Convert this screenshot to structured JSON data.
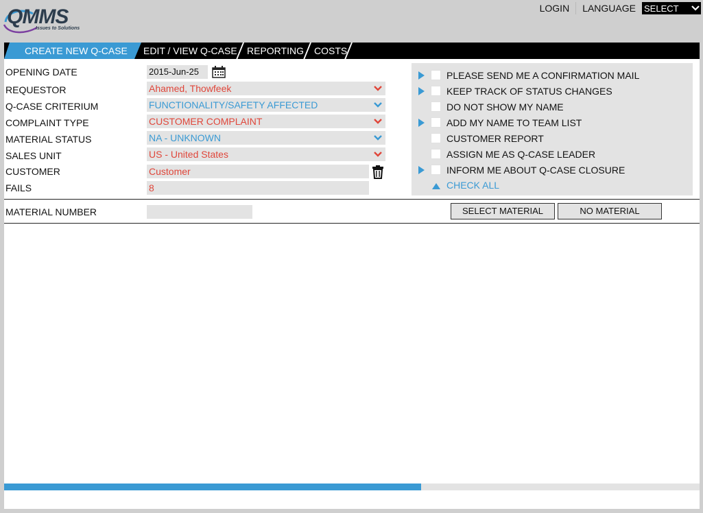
{
  "header": {
    "logo_text": "QMMS",
    "logo_tagline": "Issues to Solutions",
    "login_label": "LOGIN",
    "language_label": "LANGUAGE",
    "language_select_value": "SELECT"
  },
  "tabs": [
    {
      "label": "CREATE NEW Q-CASE",
      "active": true
    },
    {
      "label": "EDIT / VIEW Q-CASE",
      "active": false
    },
    {
      "label": "REPORTING",
      "active": false
    },
    {
      "label": "COSTS",
      "active": false
    }
  ],
  "form": {
    "opening_date": {
      "label": "OPENING DATE",
      "value": "2015-Jun-25"
    },
    "requestor": {
      "label": "REQUESTOR",
      "value": "Ahamed, Thowfeek"
    },
    "criterium": {
      "label": "Q-CASE CRITERIUM",
      "value": "FUNCTIONALITY/SAFETY AFFECTED"
    },
    "complaint_type": {
      "label": "COMPLAINT TYPE",
      "value": "CUSTOMER COMPLAINT"
    },
    "material_status": {
      "label": "MATERIAL STATUS",
      "value": "NA - UNKNOWN"
    },
    "sales_unit": {
      "label": "SALES UNIT",
      "value": "US - United States"
    },
    "customer": {
      "label": "CUSTOMER",
      "value": "Customer"
    },
    "fails": {
      "label": "FAILS",
      "value": "8"
    }
  },
  "options": {
    "items": [
      {
        "label": "PLEASE SEND ME A CONFIRMATION MAIL",
        "has_arrow": true
      },
      {
        "label": "KEEP TRACK OF STATUS CHANGES",
        "has_arrow": true
      },
      {
        "label": "DO NOT SHOW MY NAME",
        "has_arrow": false
      },
      {
        "label": "ADD MY NAME TO TEAM LIST",
        "has_arrow": true
      },
      {
        "label": "CUSTOMER REPORT",
        "has_arrow": false
      },
      {
        "label": "ASSIGN ME AS Q-CASE LEADER",
        "has_arrow": false
      },
      {
        "label": "INFORM ME ABOUT Q-CASE CLOSURE",
        "has_arrow": true
      }
    ],
    "check_all_label": "CHECK ALL"
  },
  "material": {
    "label": "MATERIAL NUMBER",
    "value": "",
    "select_button": "SELECT MATERIAL",
    "no_material_button": "NO MATERIAL"
  },
  "progress": {
    "percent": 60
  },
  "colors": {
    "accent_blue": "#3a9ad4",
    "value_red": "#e0463a",
    "field_gray": "#e3e3e3",
    "tabbar_black": "#000000"
  }
}
